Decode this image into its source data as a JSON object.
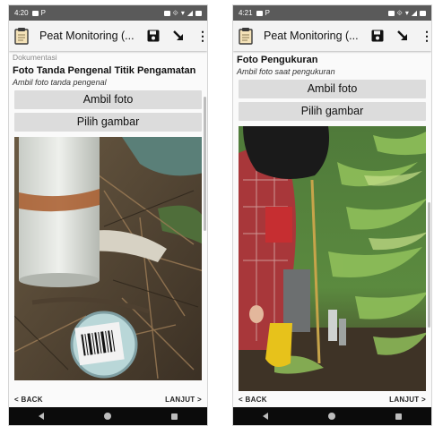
{
  "screens": [
    {
      "status": {
        "time": "4:20"
      },
      "app_bar": {
        "title": "Peat Monitoring (..."
      },
      "section_label": "Dokumentasi",
      "field": {
        "title": "Foto Tanda Pengenal Titik Pengamatan",
        "hint": "Ambil foto tanda pengenal"
      },
      "buttons": {
        "take_photo": "Ambil foto",
        "choose_image": "Pilih gambar"
      },
      "nav": {
        "back": "< BACK",
        "next": "LANJUT >"
      }
    },
    {
      "status": {
        "time": "4:21"
      },
      "app_bar": {
        "title": "Peat Monitoring (..."
      },
      "field": {
        "title": "Foto Pengukuran",
        "hint": "Ambil foto saat pengukuran"
      },
      "buttons": {
        "take_photo": "Ambil foto",
        "choose_image": "Pilih gambar"
      },
      "nav": {
        "back": "< BACK",
        "next": "LANJUT >"
      }
    }
  ],
  "icons": {
    "app": "clipboard-icon",
    "save": "save-icon",
    "navigate": "arrow-down-right-icon",
    "menu": "more-vertical-icon"
  },
  "colors": {
    "status_bar": "#5a5a5a",
    "app_bar": "#f3f3f3",
    "button": "#dcdcdc",
    "system_nav": "#0b0b0b"
  }
}
